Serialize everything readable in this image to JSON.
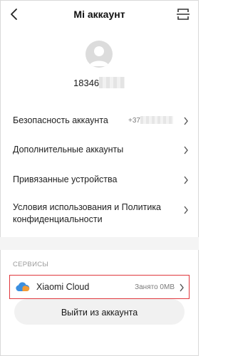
{
  "header": {
    "title": "Mi аккаунт",
    "back_icon": "back-arrow-icon",
    "scan_icon": "scan-icon"
  },
  "profile": {
    "avatar_icon": "user-avatar-icon",
    "user_id_visible": "18346"
  },
  "menu": [
    {
      "label": "Безопасность аккаунта",
      "value": "+37"
    },
    {
      "label": "Дополнительные аккаунты"
    },
    {
      "label": "Привязанные устройства"
    },
    {
      "label": "Условия использования и Политика конфиденциальности"
    }
  ],
  "services": {
    "section_label": "СЕРВИСЫ",
    "cloud": {
      "label": "Xiaomi Cloud",
      "usage": "Занято 0MB",
      "icon": "xiaomi-cloud-icon",
      "highlight_color": "#e0373d"
    }
  },
  "logout_label": "Выйти из аккаунта",
  "colors": {
    "background": "#ffffff",
    "section_divider": "#f4f4f4",
    "logout_button": "#f1f1f1",
    "secondary_text": "#7a7a7a"
  }
}
